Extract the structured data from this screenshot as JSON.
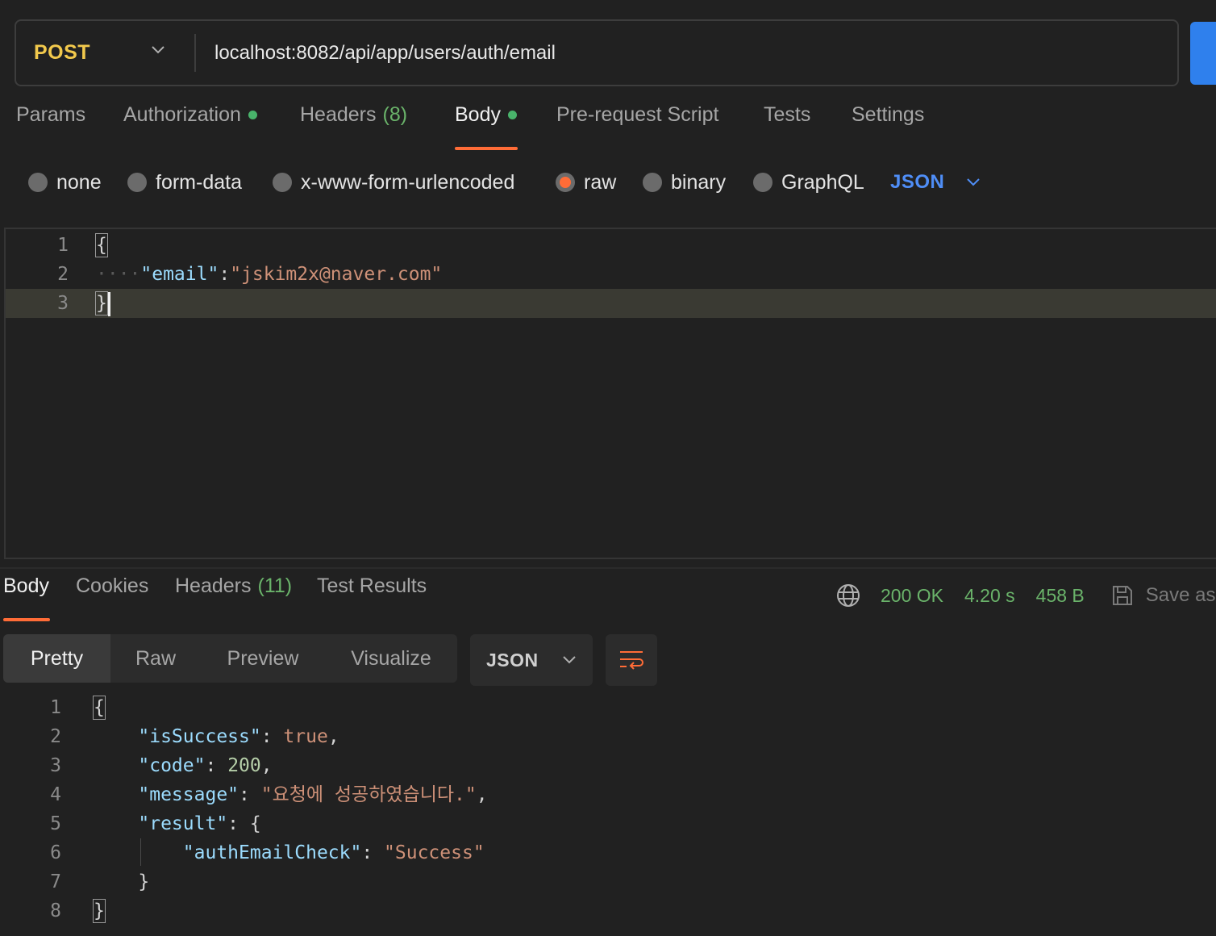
{
  "request": {
    "method": "POST",
    "url": "localhost:8082/api/app/users/auth/email"
  },
  "request_tabs": [
    {
      "label": "Params"
    },
    {
      "label": "Authorization",
      "dot": true
    },
    {
      "label": "Headers",
      "count": "(8)"
    },
    {
      "label": "Body",
      "dot": true,
      "active": true
    },
    {
      "label": "Pre-request Script"
    },
    {
      "label": "Tests"
    },
    {
      "label": "Settings"
    }
  ],
  "body_types": {
    "options": [
      "none",
      "form-data",
      "x-www-form-urlencoded",
      "raw",
      "binary",
      "GraphQL"
    ],
    "selected": "raw",
    "language": "JSON"
  },
  "request_body": {
    "line_numbers": [
      "1",
      "2",
      "3"
    ],
    "open_brace": "{",
    "indent_dots": "····",
    "key": "\"email\"",
    "colon": ":",
    "value": "\"jskim2x@naver.com\"",
    "close_brace": "}"
  },
  "response_tabs": [
    {
      "label": "Body",
      "active": true
    },
    {
      "label": "Cookies"
    },
    {
      "label": "Headers",
      "count": "(11)"
    },
    {
      "label": "Test Results"
    }
  ],
  "response_status": {
    "status": "200 OK",
    "time": "4.20 s",
    "size": "458 B",
    "save_label": "Save as"
  },
  "response_view": {
    "modes": [
      "Pretty",
      "Raw",
      "Preview",
      "Visualize"
    ],
    "active_mode": "Pretty",
    "format": "JSON"
  },
  "response_body": {
    "line_numbers": [
      "1",
      "2",
      "3",
      "4",
      "5",
      "6",
      "7",
      "8"
    ],
    "open_brace": "{",
    "close_brace": "}",
    "lines": {
      "is_success_key": "\"isSuccess\"",
      "is_success_value": "true",
      "code_key": "\"code\"",
      "code_value": "200",
      "message_key": "\"message\"",
      "message_value": "\"요청에 성공하였습니다.\"",
      "result_key": "\"result\"",
      "result_open": "{",
      "auth_key": "\"authEmailCheck\"",
      "auth_value": "\"Success\"",
      "result_close": "}"
    }
  },
  "colors": {
    "method": "#f2c94c",
    "accent": "#ff6c37",
    "status_ok": "#6ab36a",
    "link_blue": "#4f8ef7",
    "send_button": "#2f80ed"
  }
}
